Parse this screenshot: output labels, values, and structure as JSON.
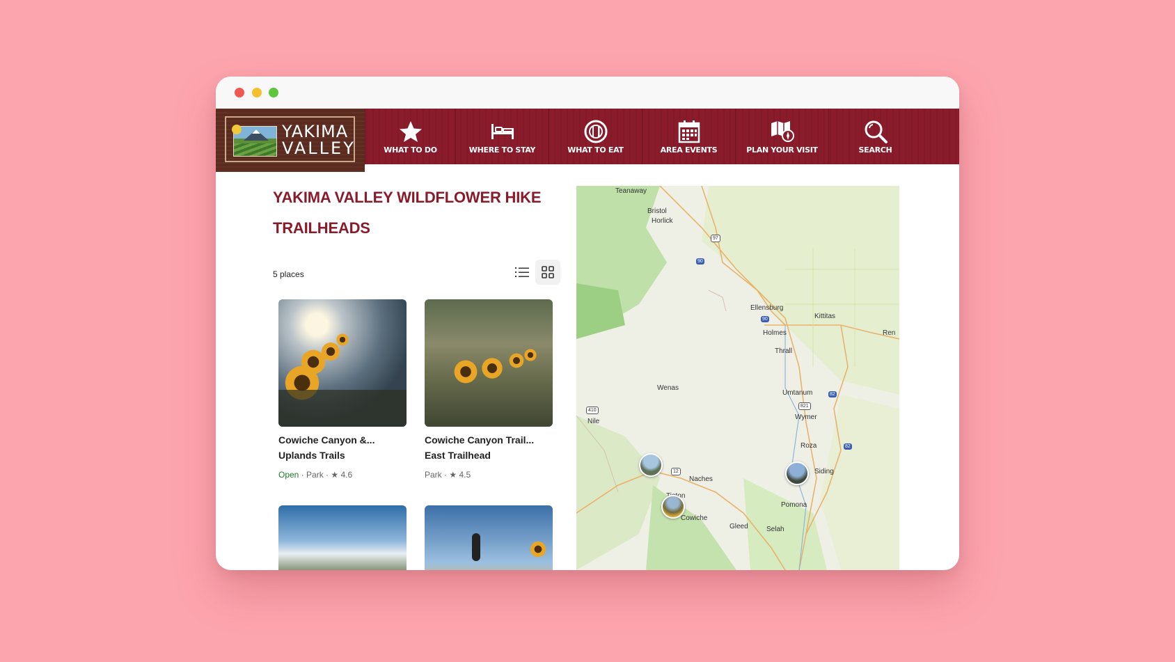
{
  "logo": {
    "line1": "YAKIMA",
    "line2": "VALLEY"
  },
  "nav": [
    {
      "label": "WHAT TO DO",
      "icon": "star-icon"
    },
    {
      "label": "WHERE TO STAY",
      "icon": "bed-icon"
    },
    {
      "label": "WHAT TO EAT",
      "icon": "plate-icon"
    },
    {
      "label": "AREA EVENTS",
      "icon": "calendar-icon"
    },
    {
      "label": "PLAN YOUR VISIT",
      "icon": "map-compass-icon"
    },
    {
      "label": "SEARCH",
      "icon": "search-icon"
    }
  ],
  "page": {
    "title": "YAKIMA VALLEY WILDFLOWER HIKE TRAILHEADS",
    "count": "5 places"
  },
  "cards": [
    {
      "name": "Cowiche Canyon &... Uplands Trails",
      "status": "Open",
      "meta": " · Park · ",
      "rating": "4.6"
    },
    {
      "name": "Cowiche Canyon Trail... East Trailhead",
      "status": "",
      "meta": "Park · ",
      "rating": "4.5"
    }
  ],
  "map": {
    "labels": [
      "Teanaway",
      "Bristol",
      "Horlick",
      "Ellensburg",
      "Kittitas",
      "Holmes",
      "Thrall",
      "Ren",
      "Wenas",
      "Umtanum",
      "Wymer",
      "Nile",
      "Roza",
      "Naches",
      "Siding",
      "Tieton",
      "Cowiche",
      "Pomona",
      "Gleed",
      "Selah"
    ],
    "shields": [
      "97",
      "90",
      "90",
      "82",
      "821",
      "410",
      "82",
      "12"
    ]
  },
  "colors": {
    "brand": "#8a1b2b",
    "open": "#1f7a2e",
    "background": "#fda5ae"
  }
}
